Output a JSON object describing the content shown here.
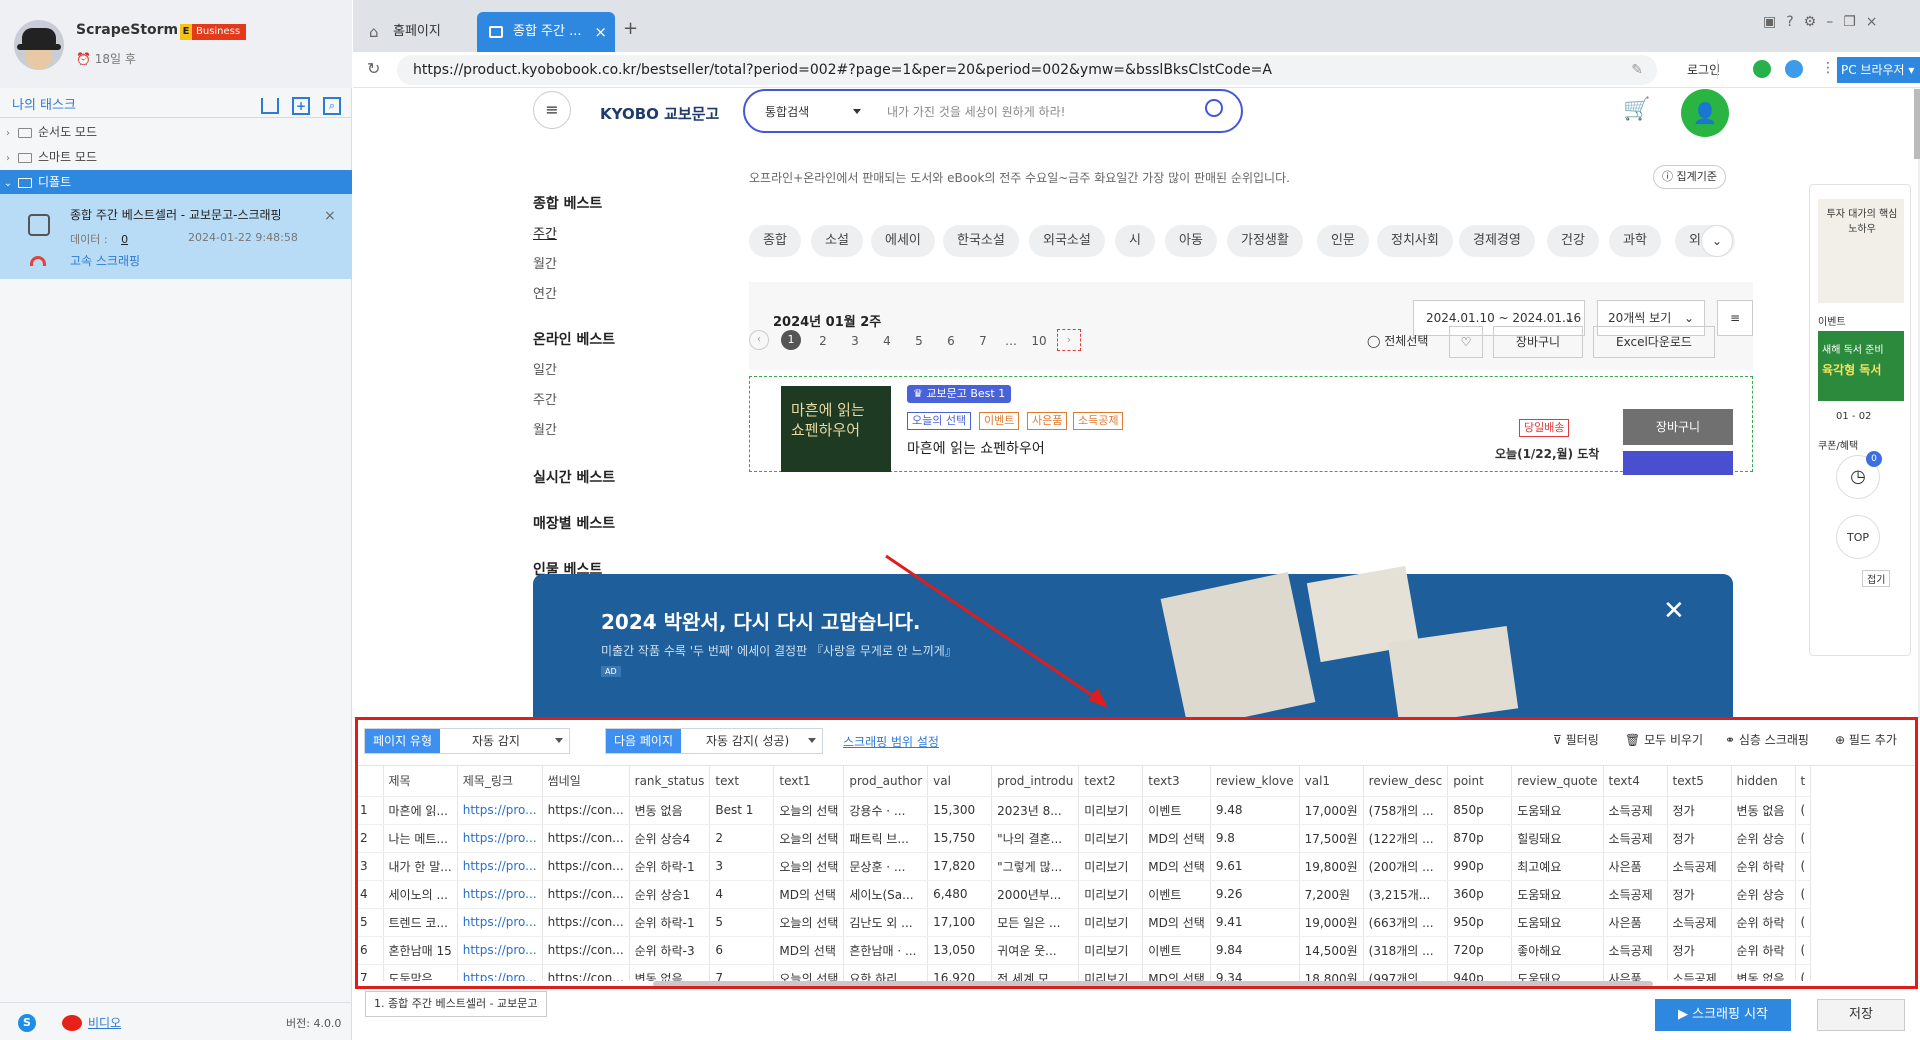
{
  "app": {
    "name": "ScrapeStorm",
    "badge": "Business",
    "expiry": "18일 후"
  },
  "sidebar": {
    "title": "나의 태스크",
    "groups": [
      {
        "label": "순서도 모드"
      },
      {
        "label": "스마트 모드"
      },
      {
        "label": "디폴트"
      }
    ]
  },
  "task": {
    "title": "종합 주간 베스트셀러 - 교보문고-스크래핑",
    "data_label": "데이터 :",
    "data_count": "0",
    "date": "2024-01-22 9:48:58",
    "mode": "고속 스크래핑"
  },
  "footer": {
    "video": "비디오",
    "version": "버전: 4.0.0"
  },
  "browser": {
    "tabs": [
      {
        "label": "홈페이지"
      },
      {
        "label": "종합 주간 ..."
      }
    ],
    "url": "https://product.kyobobook.co.kr/bestseller/total?period=002#?page=1&per=20&period=002&ymw=&bsslBksClstCode=A",
    "login": "로그인",
    "pc_browser": "PC 브라우저"
  },
  "site": {
    "logo": "KYOBO 교보문고",
    "search_type": "통합검색",
    "search_placeholder": "내가 가진 것을 세상이 원하게 하라!",
    "notice": "오프라인+온라인에서 판매되는 도서와 eBook의 전주 수요일~금주 화요일간 가장 많이 판매된 순위입니다.",
    "criteria": "집계기준",
    "menu": [
      {
        "head": "종합 베스트",
        "items": [
          "주간",
          "월간",
          "연간"
        ]
      },
      {
        "head": "온라인 베스트",
        "items": [
          "일간",
          "주간",
          "월간"
        ]
      },
      {
        "head": "실시간 베스트",
        "items": []
      },
      {
        "head": "매장별 베스트",
        "items": []
      },
      {
        "head": "인물 베스트",
        "items": []
      }
    ],
    "categories": [
      "종합",
      "소설",
      "에세이",
      "한국소설",
      "외국소설",
      "시",
      "아동",
      "가정생활",
      "인문",
      "정치사회",
      "경제경영",
      "건강",
      "과학",
      "외"
    ],
    "week": "2024년 01월 2주",
    "range": "2024.01.10 ~ 2024.01.16",
    "per_page": "20개씩 보기",
    "pages": [
      "1",
      "2",
      "3",
      "4",
      "5",
      "6",
      "7",
      "…",
      "10"
    ],
    "select_all": "전체선택",
    "cart": "장바구니",
    "excel": "Excel다운로드",
    "best_badge": "교보문고 Best 1",
    "tags": [
      "오늘의 선택",
      "이벤트",
      "사은품",
      "소득공제"
    ],
    "book_title": "마흔에 읽는 쇼펜하우어",
    "cover_text": "마흔에 읽는 쇼펜하우어",
    "delivery": "당일배송",
    "arrival": "오늘(1/22,월) 도착",
    "cart_btn": "장바구니",
    "banner_title": "2024 박완서, 다시 다시 고맙습니다.",
    "banner_sub": "미출간 작품 수록 '두 번째' 에세이 결정판 『사랑을 무게로 안 느끼게』",
    "banner_ad": "AD",
    "side_ad1": "투자 대가의 핵심 노하우",
    "side_event": "이벤트",
    "side_ad2_a": "새해 독서 준비",
    "side_ad2_b": "육각형 독서",
    "side_pager": "01 - 02",
    "side_coupon": "쿠폰/혜택",
    "side_badge": "0",
    "top": "TOP",
    "fold": "접기"
  },
  "panel": {
    "page_type_label": "페이지 유형",
    "page_type_value": "자동 감지",
    "next_label": "다음 페이지",
    "next_value": "자동 감지( 성공)",
    "range_link": "스크래핑 범위 설정",
    "tools": [
      "필터링",
      "모두 비우기",
      "심층 스크래핑",
      "필드 추가"
    ],
    "columns": [
      "",
      "제목",
      "제목_링크",
      "썸네일",
      "rank_status",
      "text",
      "text1",
      "prod_author",
      "val",
      "prod_introdu",
      "text2",
      "text3",
      "review_klove",
      "val1",
      "review_desc",
      "point",
      "review_quote",
      "text4",
      "text5",
      "hidden",
      "t"
    ],
    "rows": [
      [
        "1",
        "마흔에 읽...",
        "https://pro...",
        "https://con...",
        "변동 없음",
        "Best 1",
        "오늘의 선택",
        "강용수 · ...",
        "15,300",
        "2023년 8...",
        "미리보기",
        "이벤트",
        "9.48",
        "17,000원",
        "(758개의 ...",
        "850p",
        "도움돼요",
        "소득공제",
        "정가",
        "변동 없음",
        "("
      ],
      [
        "2",
        "나는 메트...",
        "https://pro...",
        "https://con...",
        "순위 상승4",
        "2",
        "오늘의 선택",
        "패트릭 브...",
        "15,750",
        "\"나의 결혼...",
        "미리보기",
        "MD의 선택",
        "9.8",
        "17,500원",
        "(122개의 ...",
        "870p",
        "힐링돼요",
        "소득공제",
        "정가",
        "순위 상승",
        "("
      ],
      [
        "3",
        "내가 한 말...",
        "https://pro...",
        "https://con...",
        "순위 하락-1",
        "3",
        "오늘의 선택",
        "문상훈 · ...",
        "17,820",
        "\"그렇게 많...",
        "미리보기",
        "MD의 선택",
        "9.61",
        "19,800원",
        "(200개의 ...",
        "990p",
        "최고예요",
        "사은품",
        "소득공제",
        "순위 하락",
        "("
      ],
      [
        "4",
        "세이노의 ...",
        "https://pro...",
        "https://con...",
        "순위 상승1",
        "4",
        "MD의 선택",
        "세이노(Sa...",
        "6,480",
        "2000년부...",
        "미리보기",
        "이벤트",
        "9.26",
        "7,200원",
        "(3,215개...",
        "360p",
        "도움돼요",
        "소득공제",
        "정가",
        "순위 상승",
        "("
      ],
      [
        "5",
        "트렌드 코...",
        "https://pro...",
        "https://con...",
        "순위 하락-1",
        "5",
        "오늘의 선택",
        "김난도 외 ...",
        "17,100",
        "모든 일은 ...",
        "미리보기",
        "MD의 선택",
        "9.41",
        "19,000원",
        "(663개의 ...",
        "950p",
        "도움돼요",
        "사은품",
        "소득공제",
        "순위 하락",
        "("
      ],
      [
        "6",
        "혼한남매 15",
        "https://pro...",
        "https://con...",
        "순위 하락-3",
        "6",
        "MD의 선택",
        "흔한남매 · ...",
        "13,050",
        "귀여운 웃...",
        "미리보기",
        "이벤트",
        "9.84",
        "14,500원",
        "(318개의 ...",
        "720p",
        "좋아해요",
        "소득공제",
        "정가",
        "순위 하락",
        "("
      ],
      [
        "7",
        "도둑맞은 ...",
        "https://pro...",
        "https://con...",
        "변동 없음",
        "7",
        "오늘의 선택",
        "요한 하리 ...",
        "16,920",
        "전 세계 모...",
        "미리보기",
        "MD의 선택",
        "9.34",
        "18,800원",
        "(997개의 ...",
        "940p",
        "도움돼요",
        "사은품",
        "소득공제",
        "변동 없음",
        "("
      ]
    ],
    "task_tab": "1. 종합 주간 베스트셀러 - 교보문고",
    "start_btn": "▶ 스크래핑 시작",
    "save_btn": "저장"
  }
}
